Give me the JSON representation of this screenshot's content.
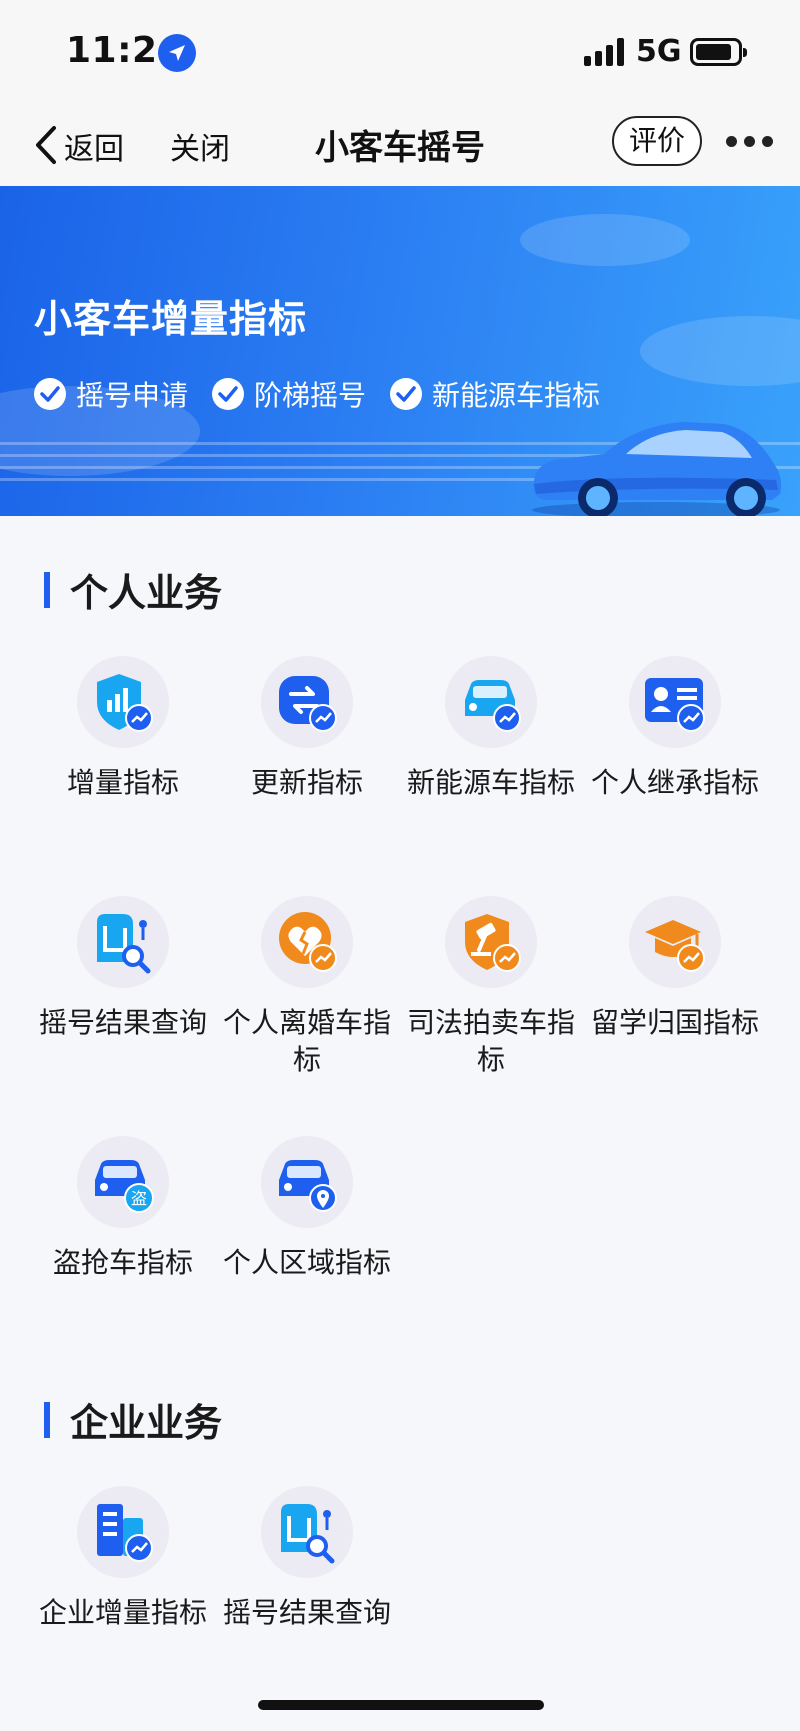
{
  "status_bar": {
    "time": "11:24",
    "network": "5G",
    "signal_bars": 4,
    "battery_level": 0.85
  },
  "nav": {
    "back_label": "返回",
    "close_label": "关闭",
    "title": "小客车摇号",
    "rate_label": "评价"
  },
  "banner": {
    "title": "小客车增量指标",
    "features": [
      "摇号申请",
      "阶梯摇号",
      "新能源车指标"
    ]
  },
  "personal": {
    "title": "个人业务",
    "items": [
      {
        "label": "增量指标",
        "icon": "shield-chart-icon"
      },
      {
        "label": "更新指标",
        "icon": "refresh-icon"
      },
      {
        "label": "新能源车指标",
        "icon": "car-icon"
      },
      {
        "label": "个人继承指标",
        "icon": "id-card-icon"
      },
      {
        "label": "摇号结果查询",
        "icon": "search-doc-icon"
      },
      {
        "label": "个人离婚车指标",
        "icon": "broken-heart-icon"
      },
      {
        "label": "司法拍卖车指标",
        "icon": "gavel-icon"
      },
      {
        "label": "留学归国指标",
        "icon": "graduation-cap-icon"
      },
      {
        "label": "盗抢车指标",
        "icon": "stolen-car-icon",
        "badge": "盗"
      },
      {
        "label": "个人区域指标",
        "icon": "car-location-icon"
      }
    ]
  },
  "enterprise": {
    "title": "企业业务",
    "items": [
      {
        "label": "企业增量指标",
        "icon": "building-icon"
      },
      {
        "label": "摇号结果查询",
        "icon": "search-doc-icon"
      }
    ]
  },
  "colors": {
    "primary": "#1e5ff0",
    "orange": "#f08a1c",
    "cyan": "#19a6f0"
  }
}
